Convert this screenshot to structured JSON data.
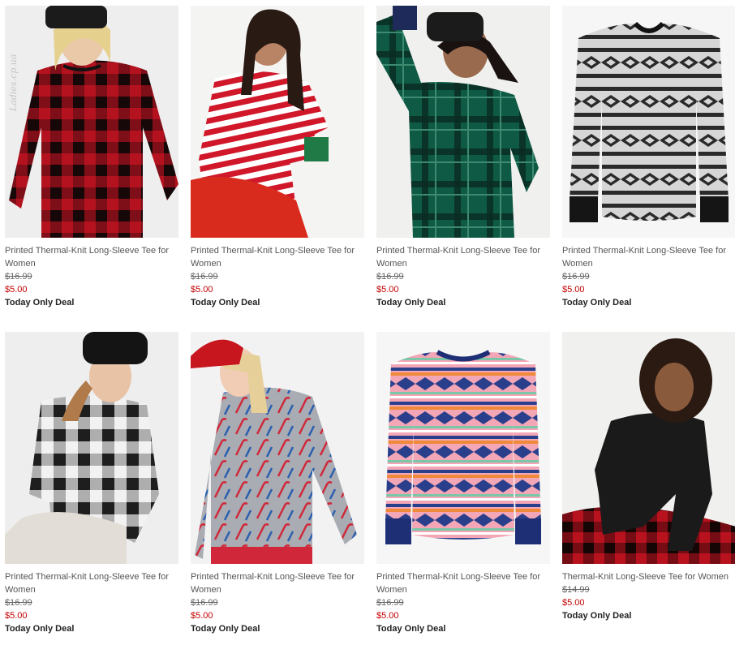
{
  "watermark": "Ladies.cp.ua",
  "products": [
    {
      "title": "Printed Thermal-Knit Long-Sleeve Tee for Women",
      "original_price": "$16.99",
      "sale_price": "$5.00",
      "deal": "Today Only Deal",
      "image": "model-red-buffalo-plaid-tee",
      "colors": {
        "shirt": "#b4121e",
        "check": "#1a0d0d",
        "bg": "#eeeeee"
      }
    },
    {
      "title": "Printed Thermal-Knit Long-Sleeve Tee for Women",
      "original_price": "$16.99",
      "sale_price": "$5.00",
      "deal": "Today Only Deal",
      "image": "model-red-white-stripe-tee",
      "colors": {
        "shirt": "#ffffff",
        "stripe": "#d0182a",
        "cuff": "#1f7a45",
        "bg": "#f4f4f2"
      }
    },
    {
      "title": "Printed Thermal-Knit Long-Sleeve Tee for Women",
      "original_price": "$16.99",
      "sale_price": "$5.00",
      "deal": "Today Only Deal",
      "image": "model-green-plaid-tee",
      "colors": {
        "shirt": "#0f5a45",
        "check": "#0a2a22",
        "bg": "#f0f0ee"
      }
    },
    {
      "title": "Printed Thermal-Knit Long-Sleeve Tee for Women",
      "original_price": "$16.99",
      "sale_price": "$5.00",
      "deal": "Today Only Deal",
      "image": "flat-gray-fair-isle-tee",
      "colors": {
        "shirt": "#cfcfcf",
        "pattern": "#2a2a2a",
        "bg": "#f6f6f6"
      }
    },
    {
      "title": "Printed Thermal-Knit Long-Sleeve Tee for Women",
      "original_price": "$16.99",
      "sale_price": "$5.00",
      "deal": "Today Only Deal",
      "image": "model-black-white-buffalo-plaid-tee",
      "colors": {
        "shirt": "#f2f2f2",
        "check": "#1e1e1e",
        "bg": "#eeeeee"
      }
    },
    {
      "title": "Printed Thermal-Knit Long-Sleeve Tee for Women",
      "original_price": "$16.99",
      "sale_price": "$5.00",
      "deal": "Today Only Deal",
      "image": "model-gray-candy-cane-tee",
      "colors": {
        "shirt": "#a9acb2",
        "pattern": "#d0283a",
        "bg": "#f2f2f2"
      }
    },
    {
      "title": "Printed Thermal-Knit Long-Sleeve Tee for Women",
      "original_price": "$16.99",
      "sale_price": "$5.00",
      "deal": "Today Only Deal",
      "image": "flat-pink-fair-isle-tee",
      "colors": {
        "shirt": "#f3a6b6",
        "pattern": "#2a3f8c",
        "bg": "#f6f6f6"
      }
    },
    {
      "title": "Thermal-Knit Long-Sleeve Tee for Women",
      "original_price": "$14.99",
      "sale_price": "$5.00",
      "deal": "Today Only Deal",
      "image": "model-black-solid-tee",
      "colors": {
        "shirt": "#1a1a1a",
        "pants": "#b8121e",
        "bg": "#f0f0ee"
      }
    }
  ]
}
